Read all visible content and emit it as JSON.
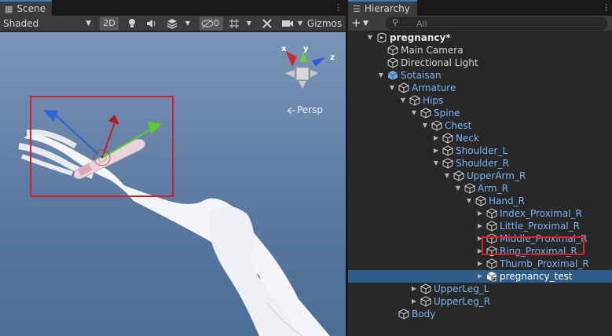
{
  "scene": {
    "tab_label": "Scene",
    "shading_mode": "Shaded",
    "toolbar": {
      "mode_2d": "2D",
      "hidden_count": "0",
      "gizmos_label": "Gizmos"
    },
    "persp_label": "Persp",
    "axes": {
      "x": "x",
      "y": "y",
      "z": "z"
    },
    "icons": [
      "scene-grid-icon",
      "kebab-icon",
      "light-icon",
      "audio-icon",
      "effects-icon",
      "visibility-icon",
      "grid-snap-icon",
      "tools-icon",
      "camera-icon"
    ]
  },
  "hierarchy": {
    "tab_label": "Hierarchy",
    "search_placeholder": "All",
    "tree": [
      {
        "label": "pregnancy*",
        "depth": 0,
        "expanded": true,
        "kind": "scene"
      },
      {
        "label": "Main Camera",
        "depth": 1,
        "kind": "object"
      },
      {
        "label": "Directional Light",
        "depth": 1,
        "kind": "object"
      },
      {
        "label": "Sotaisan",
        "depth": 1,
        "expanded": true,
        "kind": "prefab"
      },
      {
        "label": "Armature",
        "depth": 2,
        "expanded": true,
        "kind": "bone"
      },
      {
        "label": "Hips",
        "depth": 3,
        "expanded": true,
        "kind": "bone"
      },
      {
        "label": "Spine",
        "depth": 4,
        "expanded": true,
        "kind": "bone"
      },
      {
        "label": "Chest",
        "depth": 5,
        "expanded": true,
        "kind": "bone"
      },
      {
        "label": "Neck",
        "depth": 6,
        "expanded": false,
        "kind": "bone"
      },
      {
        "label": "Shoulder_L",
        "depth": 6,
        "expanded": false,
        "kind": "bone"
      },
      {
        "label": "Shoulder_R",
        "depth": 6,
        "expanded": true,
        "kind": "bone"
      },
      {
        "label": "UpperArm_R",
        "depth": 7,
        "expanded": true,
        "kind": "bone"
      },
      {
        "label": "Arm_R",
        "depth": 8,
        "expanded": true,
        "kind": "bone"
      },
      {
        "label": "Hand_R",
        "depth": 9,
        "expanded": true,
        "kind": "bone"
      },
      {
        "label": "Index_Proximal_R",
        "depth": 10,
        "expanded": false,
        "kind": "bone"
      },
      {
        "label": "Little_Proximal_R",
        "depth": 10,
        "expanded": false,
        "kind": "bone"
      },
      {
        "label": "Middle_Proximal_R",
        "depth": 10,
        "expanded": false,
        "kind": "bone"
      },
      {
        "label": "Ring_Proximal_R",
        "depth": 10,
        "expanded": false,
        "kind": "bone"
      },
      {
        "label": "Thumb_Proximal_R",
        "depth": 10,
        "expanded": false,
        "kind": "bone"
      },
      {
        "label": "pregnancy_test",
        "depth": 10,
        "expanded": false,
        "kind": "selected",
        "selected": true
      },
      {
        "label": "UpperLeg_L",
        "depth": 4,
        "expanded": false,
        "kind": "bone"
      },
      {
        "label": "UpperLeg_R",
        "depth": 4,
        "expanded": false,
        "kind": "bone"
      },
      {
        "label": "Body",
        "depth": 2,
        "kind": "bone"
      }
    ]
  },
  "colors": {
    "selection": "#2c5d87",
    "highlight": "#d21f2a",
    "bone_text": "#7cb0ee",
    "tab_accent": "#3a79bb"
  }
}
